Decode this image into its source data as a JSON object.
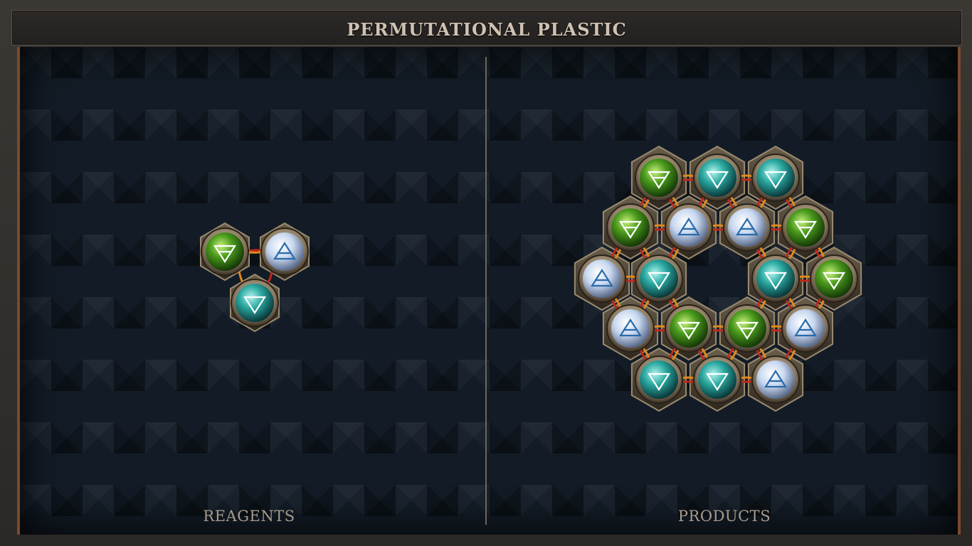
{
  "title": "PERMUTATIONAL PLASTIC",
  "panels": {
    "reagents": {
      "label": "REAGENTS"
    },
    "products": {
      "label": "PRODUCTS"
    }
  },
  "colors": {
    "green_atom": "#4a9a1c",
    "teal_atom": "#2aa8a0",
    "white_atom": "#c8d8f0",
    "frame_bronze": "#8a7a62",
    "bond_red": "#c0281c",
    "bond_orange": "#e08a1c",
    "triplex_bond": "#9aa2aa"
  },
  "reagent_molecule": {
    "atoms": [
      {
        "element": "earth",
        "symbol": "earth-icon"
      },
      {
        "element": "air",
        "symbol": "air-icon"
      },
      {
        "element": "water",
        "symbol": "water-icon"
      }
    ]
  },
  "product_molecule": {
    "atoms": [
      {
        "element": "earth",
        "symbol": "earth-icon"
      },
      {
        "element": "water",
        "symbol": "water-icon"
      },
      {
        "element": "water",
        "symbol": "water-icon"
      },
      {
        "element": "earth",
        "symbol": "earth-icon"
      },
      {
        "element": "air",
        "symbol": "air-icon"
      },
      {
        "element": "air",
        "symbol": "air-icon"
      },
      {
        "element": "earth",
        "symbol": "earth-icon"
      },
      {
        "element": "air",
        "symbol": "air-icon"
      },
      {
        "element": "water",
        "symbol": "water-icon"
      },
      {
        "element": "water",
        "symbol": "water-icon"
      },
      {
        "element": "earth",
        "symbol": "earth-icon"
      },
      {
        "element": "air",
        "symbol": "air-icon"
      },
      {
        "element": "earth",
        "symbol": "earth-icon"
      },
      {
        "element": "earth",
        "symbol": "earth-icon"
      },
      {
        "element": "air",
        "symbol": "air-icon"
      },
      {
        "element": "water",
        "symbol": "water-icon"
      },
      {
        "element": "water",
        "symbol": "water-icon"
      },
      {
        "element": "air",
        "symbol": "air-icon"
      }
    ]
  }
}
